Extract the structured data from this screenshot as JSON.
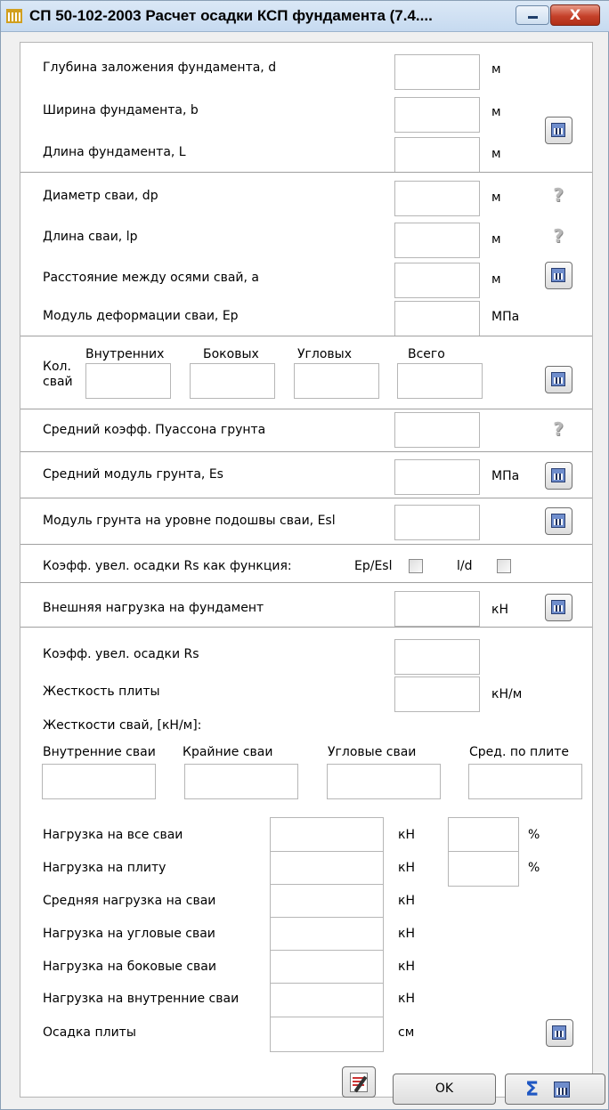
{
  "window": {
    "title": "СП 50-102-2003 Расчет осадки КСП фундамента (7.4....",
    "close_label": "X"
  },
  "foundation": {
    "depth_label": "Глубина заложения фундамента, d",
    "width_label": "Ширина фундамента, b",
    "length_label": "Длина фундамента, L",
    "unit_m": "м"
  },
  "piles": {
    "diameter_label": "Диаметр сваи, dp",
    "length_label": "Длина сваи, lp",
    "spacing_label": "Расстояние между осями свай, a",
    "modulus_label": "Модуль деформации сваи, Ep",
    "unit_m": "м",
    "unit_mpa": "МПа",
    "help_glyph": "?"
  },
  "pile_count": {
    "label_line1": "Кол.",
    "label_line2": "свай",
    "inner": "Внутренних",
    "side": "Боковых",
    "corner": "Угловых",
    "total": "Всего"
  },
  "soil": {
    "poisson_label": "Средний коэфф. Пуассона грунта",
    "modulus_label": "Средний модуль  грунта, Es",
    "modulus_unit": "МПа",
    "base_modulus_label": "Модуль грунта на уровне подошвы сваи, Esl"
  },
  "rs_function": {
    "label": "Коэфф. увел. осадки Rs как функция:",
    "opt1": "Ep/Esl",
    "opt2": "l/d"
  },
  "load": {
    "label": "Внешняя нагрузка на фундамент",
    "unit": "кН"
  },
  "results": {
    "rs_label": "Коэфф. увел. осадки Rs",
    "stiffness_label": "Жесткость плиты",
    "stiffness_unit": "кН/м",
    "pile_stiffness_label": "Жесткости свай, [кН/м]:",
    "inner_piles": "Внутренние сваи",
    "edge_piles": "Крайние сваи",
    "corner_piles": "Угловые сваи",
    "avg_plate": "Сред. по плите",
    "all_piles_load": "Нагрузка на все сваи",
    "plate_load": "Нагрузка на плиту",
    "avg_pile_load": "Средняя нагрузка на сваи",
    "corner_pile_load": "Нагрузка на угловые сваи",
    "side_pile_load": "Нагрузка на боковые сваи",
    "inner_pile_load": "Нагрузка на внутренние сваи",
    "settlement": "Осадка плиты",
    "unit_kn": "кН",
    "unit_pct": "%",
    "unit_cm": "см"
  },
  "footer": {
    "ok_label": "OK",
    "sum_label": "Σ"
  },
  "colors": {
    "title_bar": "#c6daf0",
    "close_button": "#c5412a",
    "calculator_icon": "#6f8dcc"
  },
  "icons": [
    "app-icon",
    "calculator-icon",
    "help-icon",
    "edit-report-icon",
    "sigma-icon",
    "minimize-icon",
    "close-icon"
  ]
}
